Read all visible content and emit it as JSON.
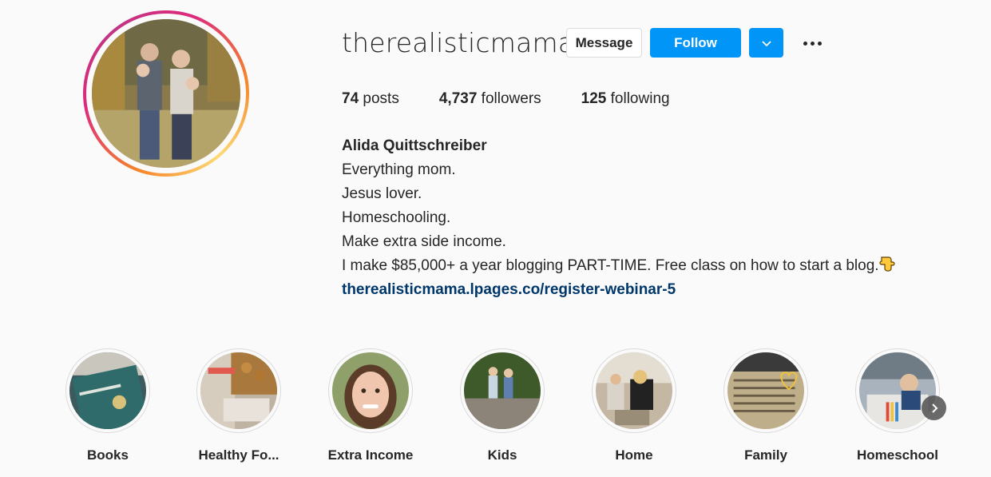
{
  "profile": {
    "username": "therealisticmama",
    "message_label": "Message",
    "follow_label": "Follow",
    "stats": {
      "posts_count": "74",
      "posts_label": "posts",
      "followers_count": "4,737",
      "followers_label": "followers",
      "following_count": "125",
      "following_label": "following"
    },
    "bio": {
      "full_name": "Alida Quittschreiber",
      "lines": [
        "Everything mom.",
        "Jesus lover.",
        "Homeschooling.",
        "Make extra side income.",
        "I make $85,000+ a year blogging PART-TIME. Free class on how to start a blog."
      ],
      "emoji": "pointing-down-emoji",
      "link": "therealisticmama.lpages.co/register-webinar-5"
    }
  },
  "highlights": [
    {
      "label": "Books"
    },
    {
      "label": "Healthy Fo..."
    },
    {
      "label": "Extra Income"
    },
    {
      "label": "Kids"
    },
    {
      "label": "Home"
    },
    {
      "label": "Family"
    },
    {
      "label": "Homeschool"
    }
  ],
  "colors": {
    "follow_blue": "#0095f6",
    "link_blue": "#00376b",
    "text": "#262626",
    "background": "#fafafa"
  },
  "icons": {
    "dropdown": "chevron-down-icon",
    "more": "more-options-icon",
    "next": "chevron-right-icon"
  }
}
